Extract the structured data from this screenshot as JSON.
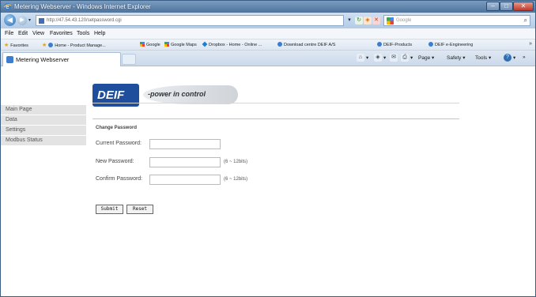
{
  "window": {
    "title": "Metering Webserver - Windows Internet Explorer",
    "min_glyph": "–",
    "max_glyph": "□",
    "close_glyph": "✕"
  },
  "address_bar": {
    "back_glyph": "◀",
    "forward_glyph": "▶",
    "dropdown_glyph": "▾",
    "url": "http://47.54.43.120/setpassword.cgi",
    "search_placeholder": "Google",
    "search_glyph": "⌕",
    "refresh_glyph": "↻",
    "rss_glyph": "◈",
    "stop_glyph": "✕"
  },
  "menu": [
    "File",
    "Edit",
    "View",
    "Favorites",
    "Tools",
    "Help"
  ],
  "favorites_bar": {
    "label": "Favorites",
    "items": [
      "Home - Product Manage...",
      "Google",
      "Google Maps",
      "Dropbox - Home - Online ...",
      "Download centre DEIF A/S",
      "DEIF-Products",
      "DEIF e-Engineering"
    ],
    "more_glyph": "»"
  },
  "tab": {
    "label": "Metering Webserver"
  },
  "command_bar": {
    "home_glyph": "⌂",
    "feeds_glyph": "◈",
    "mail_glyph": "✉",
    "print_glyph": "⎙",
    "dropdown_glyph": "▾",
    "page_label": "Page",
    "safety_label": "Safety",
    "tools_label": "Tools",
    "help_glyph": "?",
    "extra_glyph": "»"
  },
  "logo": {
    "brand": "DEIF",
    "tagline": "-power in control"
  },
  "nav": [
    "Main Page",
    "Data",
    "Settings",
    "Modbus Status"
  ],
  "form": {
    "title": "Change Password",
    "current_label": "Current Password:",
    "new_label": "New Password:",
    "confirm_label": "Confirm Password:",
    "new_hint": "(6 ~ 12bits)",
    "confirm_hint": "(6 ~ 12bits)",
    "submit_label": "Submit",
    "reset_label": "Reset"
  }
}
